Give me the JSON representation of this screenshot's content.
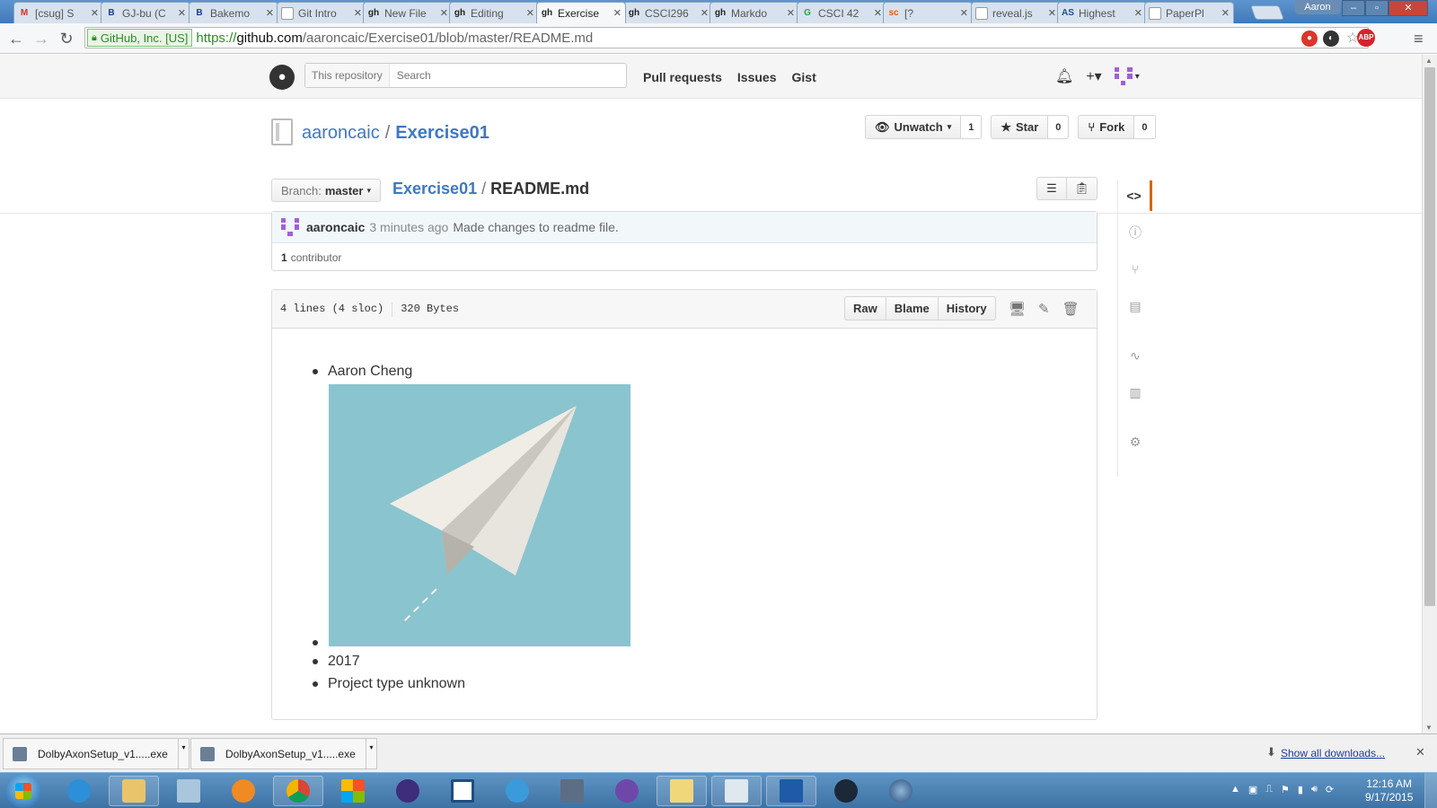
{
  "browser": {
    "tabs": [
      {
        "label": "[csug] S",
        "favicon": "M",
        "favicon_color": "#d93025"
      },
      {
        "label": "GJ-bu (C",
        "favicon": "B",
        "favicon_color": "#1e3f8a"
      },
      {
        "label": "Bakemo",
        "favicon": "B",
        "favicon_color": "#1e3f8a"
      },
      {
        "label": "Git Intro",
        "favicon": "",
        "favicon_color": "#999999"
      },
      {
        "label": "New File",
        "favicon": "gh",
        "favicon_color": "#222222"
      },
      {
        "label": "Editing",
        "favicon": "gh",
        "favicon_color": "#222222"
      },
      {
        "label": "Exercise",
        "favicon": "gh",
        "favicon_color": "#222222"
      },
      {
        "label": "CSCI296",
        "favicon": "gh",
        "favicon_color": "#222222"
      },
      {
        "label": "Markdo",
        "favicon": "gh",
        "favicon_color": "#222222"
      },
      {
        "label": "CSCI 42",
        "favicon": "G",
        "favicon_color": "#2e9f4a"
      },
      {
        "label": "[?",
        "favicon": "sc",
        "favicon_color": "#ff5500"
      },
      {
        "label": "reveal.js",
        "favicon": "",
        "favicon_color": "#999999"
      },
      {
        "label": "Highest",
        "favicon": "AS",
        "favicon_color": "#1e4f8a"
      },
      {
        "label": "PaperPl",
        "favicon": "",
        "favicon_color": "#999999"
      }
    ],
    "active_tab_index": 6,
    "profile_name": "Aaron",
    "ev_label": "GitHub, Inc. [US]",
    "url_scheme": "https://",
    "url_host": "github.com",
    "url_path": "/aaroncaic/Exercise01/blob/master/README.md"
  },
  "github": {
    "search_scope": "This repository",
    "search_placeholder": "Search",
    "nav": [
      "Pull requests",
      "Issues",
      "Gist"
    ],
    "repo_owner": "aaroncaic",
    "repo_separator": "/",
    "repo_name": "Exercise01",
    "watch_label": "Unwatch",
    "watch_count": "1",
    "star_label": "Star",
    "star_count": "0",
    "fork_label": "Fork",
    "fork_count": "0",
    "branch_label": "Branch:",
    "branch_value": "master",
    "breadcrumb_root": "Exercise01",
    "breadcrumb_slash": "/",
    "breadcrumb_file": "README.md",
    "commit_author": "aaroncaic",
    "commit_time": "3 minutes ago",
    "commit_message": "Made changes to readme file.",
    "contributor_count": "1",
    "contributor_label": "contributor",
    "file_lines": "4 lines (4 sloc)",
    "file_size": "320 Bytes",
    "file_actions": [
      "Raw",
      "Blame",
      "History"
    ],
    "readme_items": [
      "Aaron Cheng",
      "2017",
      "Project type unknown"
    ],
    "accent_color": "#4078c0",
    "reponav_active_color": "#d26911"
  },
  "downloads": {
    "items": [
      "DolbyAxonSetup_v1.....exe",
      "DolbyAxonSetup_v1.....exe"
    ],
    "show_all": "Show all downloads...",
    "close": "✕"
  },
  "taskbar": {
    "time": "12:16 AM",
    "date": "9/17/2015"
  }
}
